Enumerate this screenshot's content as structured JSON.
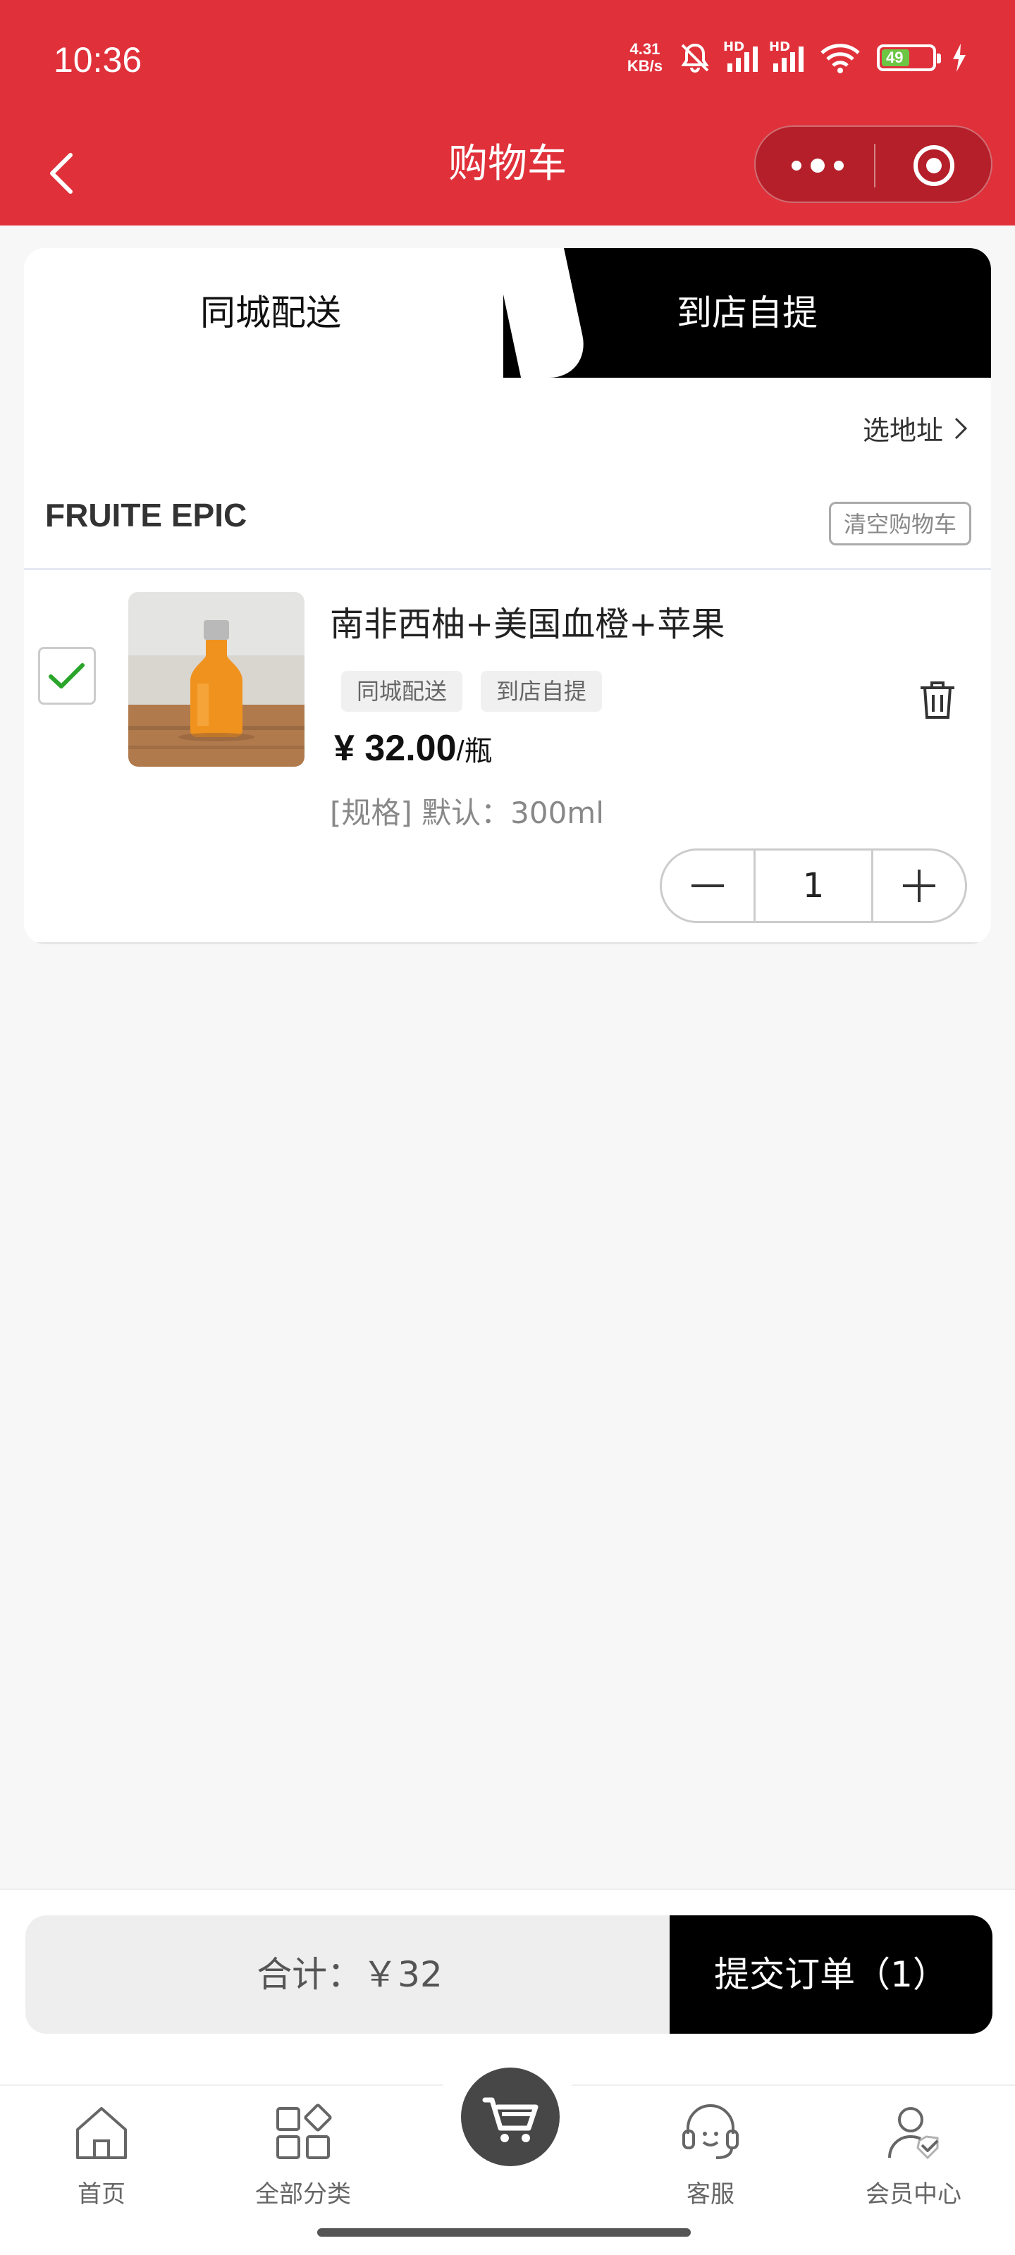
{
  "status_bar": {
    "time": "10:36",
    "net_speed_value": "4.31",
    "net_speed_unit": "KB/s",
    "sim1_label": "HD",
    "sim2_label": "HD",
    "battery_level": "49"
  },
  "header": {
    "title": "购物车"
  },
  "tabs": {
    "delivery": "同城配送",
    "pickup": "到店自提",
    "active": "delivery"
  },
  "address_link": "选地址",
  "store": {
    "name": "FRUITE EPIC",
    "clear_cart": "清空购物车"
  },
  "cart_items": [
    {
      "name": "南非西柚+美国血橙+苹果",
      "tags": [
        "同城配送",
        "到店自提"
      ],
      "price": "¥ 32.00",
      "unit": "/瓶",
      "spec": "[规格] 默认：300ml",
      "quantity": "1",
      "checked": true
    }
  ],
  "checkout": {
    "total": "合计：￥32",
    "submit": "提交订单（1）"
  },
  "tabbar": {
    "home": "首页",
    "categories": "全部分类",
    "service": "客服",
    "member": "会员中心"
  },
  "colors": {
    "brand_red": "#e0313b",
    "black": "#000000",
    "check_green": "#2aa52a"
  }
}
